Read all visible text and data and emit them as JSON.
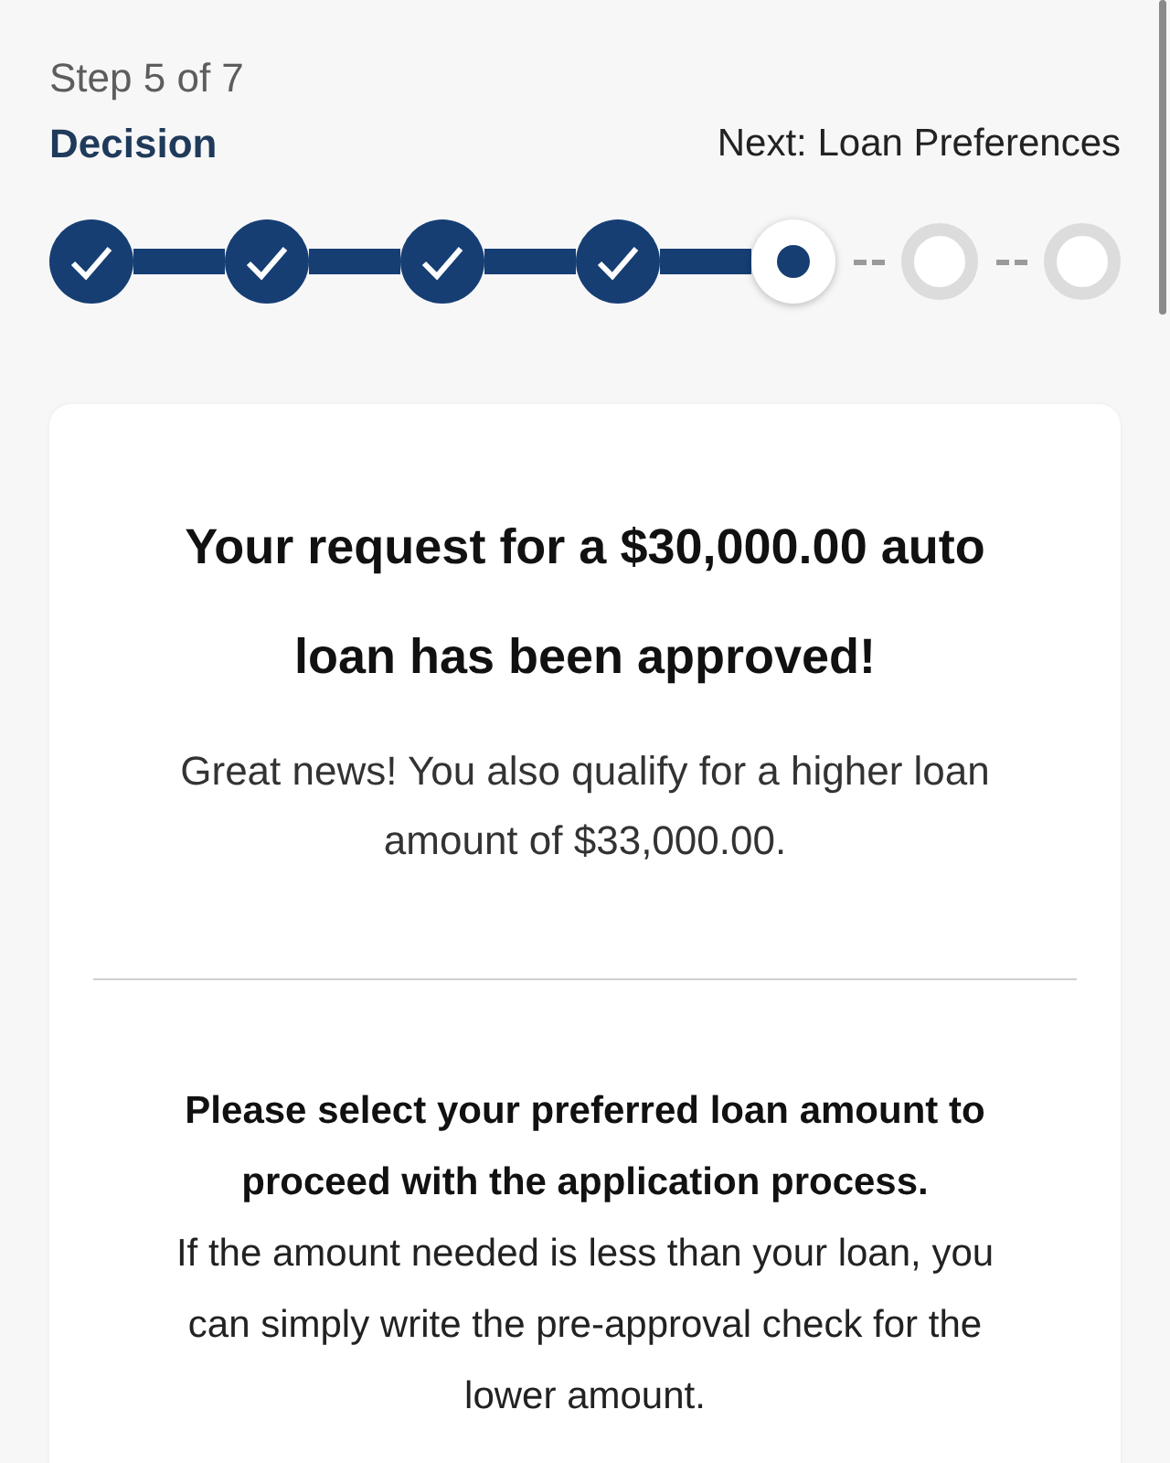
{
  "progress": {
    "step_label": "Step 5 of 7",
    "current_title": "Decision",
    "next_label": "Next: Loan Preferences"
  },
  "steps": [
    {
      "done": true,
      "current": false
    },
    {
      "done": true,
      "current": false
    },
    {
      "done": true,
      "current": false
    },
    {
      "done": true,
      "current": false
    },
    {
      "done": false,
      "current": true
    },
    {
      "done": false,
      "current": false
    },
    {
      "done": false,
      "current": false
    }
  ],
  "card": {
    "heading": "Your request for a $30,000.00 auto loan has been approved!",
    "subtext": "Great news! You also qualify for a higher loan amount of $33,000.00.",
    "instruction_bold": "Please select your preferred loan amount to proceed with the application process.",
    "instruction": "If the amount needed is less than your loan, you can simply write the pre-approval check for the lower amount."
  }
}
